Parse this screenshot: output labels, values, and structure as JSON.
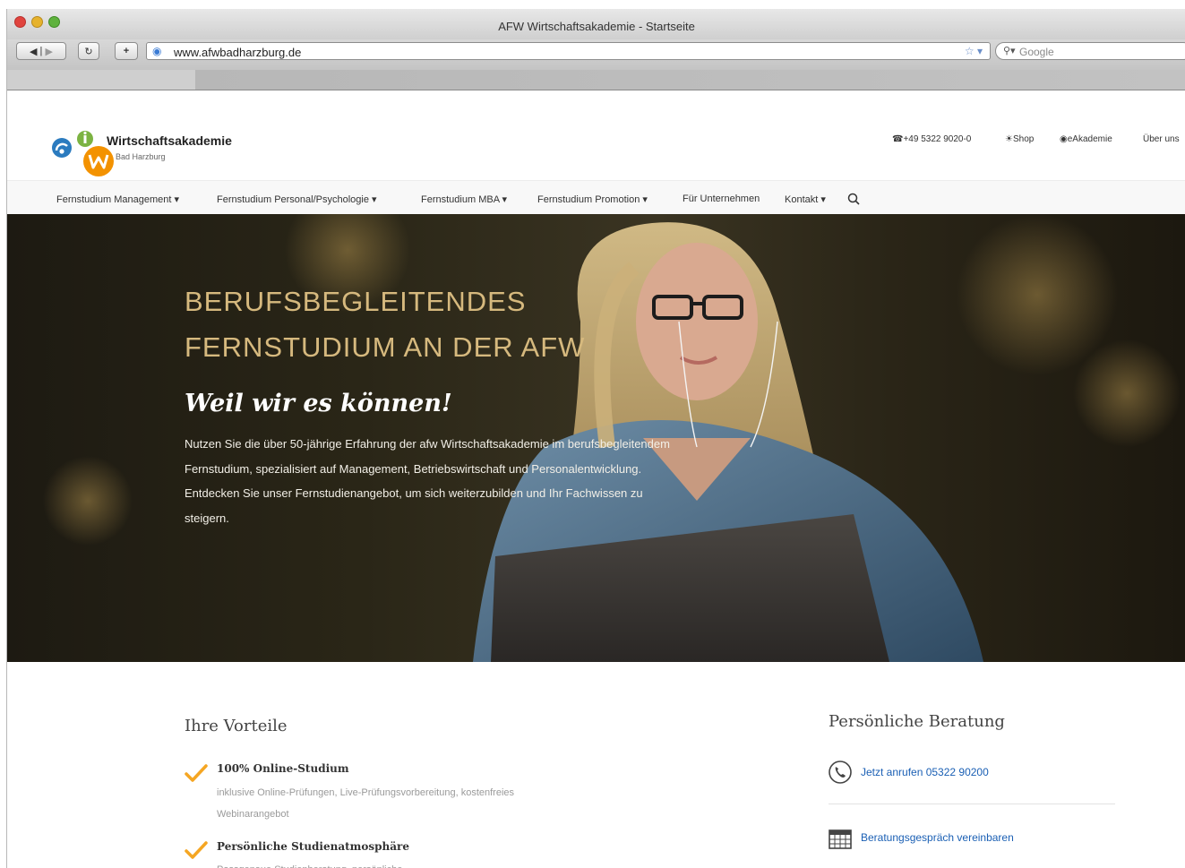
{
  "browser": {
    "window_title": "AFW Wirtschaftsakademie - Startseite",
    "url": "www.afwbadharzburg.de",
    "search_placeholder": "Google"
  },
  "site": {
    "brand_name": "Wirtschaftsakademie",
    "brand_sub": "Bad Harzburg",
    "topnav": {
      "phone": "☎+49 5322 9020-0",
      "shop": "☀Shop",
      "eakademie": "◉eAkademie",
      "ueber": "Über uns"
    },
    "mainnav": {
      "management": "Fernstudium Management ▾",
      "personal": "Fernstudium Personal/Psychologie ▾",
      "mba": "Fernstudium MBA ▾",
      "promotion": "Fernstudium Promotion ▾",
      "unternehmen": "Für Unternehmen",
      "kontakt": "Kontakt ▾"
    },
    "hero": {
      "headline_1": "BERUFSBEGLEITENDES",
      "headline_2": "FERNSTUDIUM AN DER AFW",
      "tagline": "Weil wir es können!",
      "body": "Nutzen Sie die über 50-jährige Erfahrung der afw Wirtschaftsakademie im berufsbegleitendem Fernstudium, spezialisiert auf Management, Betriebswirtschaft und Personalentwicklung. Entdecken Sie unser Fernstudienangebot, um sich weiterzubilden und Ihr Fachwissen zu steigern."
    },
    "vorteile": {
      "title": "Ihre Vorteile",
      "items": [
        {
          "title": "100% Online-Studium",
          "desc": "inklusive Online-Prüfungen, Live-Prüfungsvorbereitung, kostenfreies Webinarangebot"
        },
        {
          "title": "Persönliche Studienatmosphäre",
          "desc": "Passgenaue Studienberatung, persönliche"
        }
      ]
    },
    "beratung": {
      "title": "Persönliche Beratung",
      "call": "Jetzt anrufen 05322 90200",
      "appointment": "Beratungsgespräch vereinbaren"
    }
  },
  "colors": {
    "hero_headline": "#d6b97e",
    "check": "#f5a623",
    "link": "#1a5fb4",
    "logo_blue": "#2b7bbf",
    "logo_green": "#7cb342",
    "logo_orange": "#f39200"
  },
  "icons": [
    "back-icon",
    "forward-icon",
    "reload-icon",
    "add-icon",
    "globe-icon",
    "star-icon",
    "search-icon",
    "phone-icon",
    "calendar-icon",
    "checkmark-icon"
  ]
}
